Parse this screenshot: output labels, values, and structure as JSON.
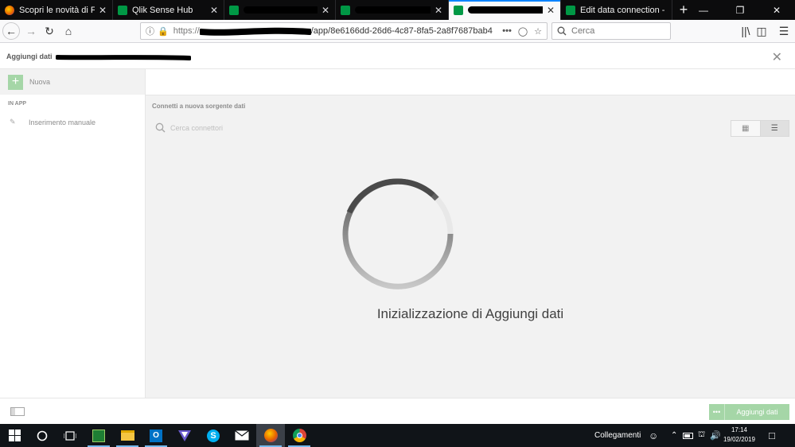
{
  "browser": {
    "tabs": [
      {
        "title": "Scopri le novità di Firefox",
        "icon": "firefox-icon",
        "favicon_color": "#e66000",
        "redacted": false
      },
      {
        "title": "Qlik Sense Hub",
        "icon": "qlik-icon",
        "favicon_color": "#009845",
        "redacted": false
      },
      {
        "title": "",
        "icon": "qlik-icon",
        "favicon_color": "#009845",
        "redacted": true
      },
      {
        "title": "",
        "icon": "qlik-icon",
        "favicon_color": "#009845",
        "redacted": true
      },
      {
        "title": "",
        "icon": "qlik-icon",
        "favicon_color": "#009845",
        "redacted": true,
        "active": true
      },
      {
        "title": "Edit data connection - Q",
        "icon": "qlik-icon",
        "favicon_color": "#009845",
        "redacted": false
      }
    ],
    "new_tab_label": "+",
    "url_proto": "https://",
    "url_tail": "/app/8e6166dd-26d6-4c87-8fa5-2a8f7687bab4",
    "search_placeholder": "Cerca"
  },
  "app": {
    "header_title": "Aggiungi dati",
    "new_label": "Nuova",
    "section_in_app": "IN APP",
    "manual_entry": "Inserimento manuale",
    "connect_heading": "Connetti a nuova sorgente dati",
    "search_placeholder": "Cerca connettori",
    "loading_text": "Inizializzazione di Aggiungi dati",
    "add_data_button": "Aggiungi dati",
    "accent": "#a5d6a7"
  },
  "taskbar": {
    "network_label": "Collegamenti",
    "time": "17:14",
    "date": "19/02/2019"
  }
}
